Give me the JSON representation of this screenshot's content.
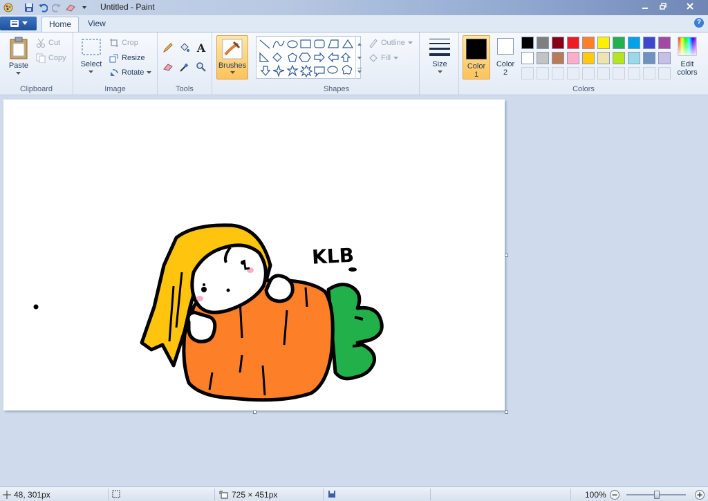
{
  "window": {
    "title": "Untitled - Paint"
  },
  "tabs": {
    "file_icon": "menu-icon",
    "home": "Home",
    "view": "View"
  },
  "help": "?",
  "clipboard": {
    "paste": "Paste",
    "cut": "Cut",
    "copy": "Copy",
    "label": "Clipboard"
  },
  "image": {
    "select": "Select",
    "crop": "Crop",
    "resize": "Resize",
    "rotate": "Rotate",
    "label": "Image"
  },
  "tools": {
    "label": "Tools",
    "text_tool": "A"
  },
  "brushes": {
    "label": "Brushes"
  },
  "shapes": {
    "outline": "Outline",
    "fill": "Fill",
    "label": "Shapes"
  },
  "size": {
    "label": "Size"
  },
  "colors": {
    "color1": "Color 1",
    "color1_line1": "Color",
    "color1_line2": "1",
    "color2_line1": "Color",
    "color2_line2": "2",
    "edit_line1": "Edit",
    "edit_line2": "colors",
    "label": "Colors",
    "color1_value": "#000000",
    "color2_value": "#ffffff",
    "palette_row1": [
      "#000000",
      "#7f7f7f",
      "#880015",
      "#ed1c24",
      "#ff7f27",
      "#fff200",
      "#22b14c",
      "#00a2e8",
      "#3f48cc",
      "#a349a4"
    ],
    "palette_row2": [
      "#ffffff",
      "#c3c3c3",
      "#b97a57",
      "#ffaec9",
      "#ffc90e",
      "#efe4b0",
      "#b5e61d",
      "#99d9ea",
      "#7092be",
      "#c8bfe7"
    ]
  },
  "canvas": {
    "signature": "KLB"
  },
  "status": {
    "cursor_pos": "48, 301px",
    "canvas_size": "725 × 451px",
    "zoom": "100%",
    "zoom_slider_fraction": 0.5
  }
}
